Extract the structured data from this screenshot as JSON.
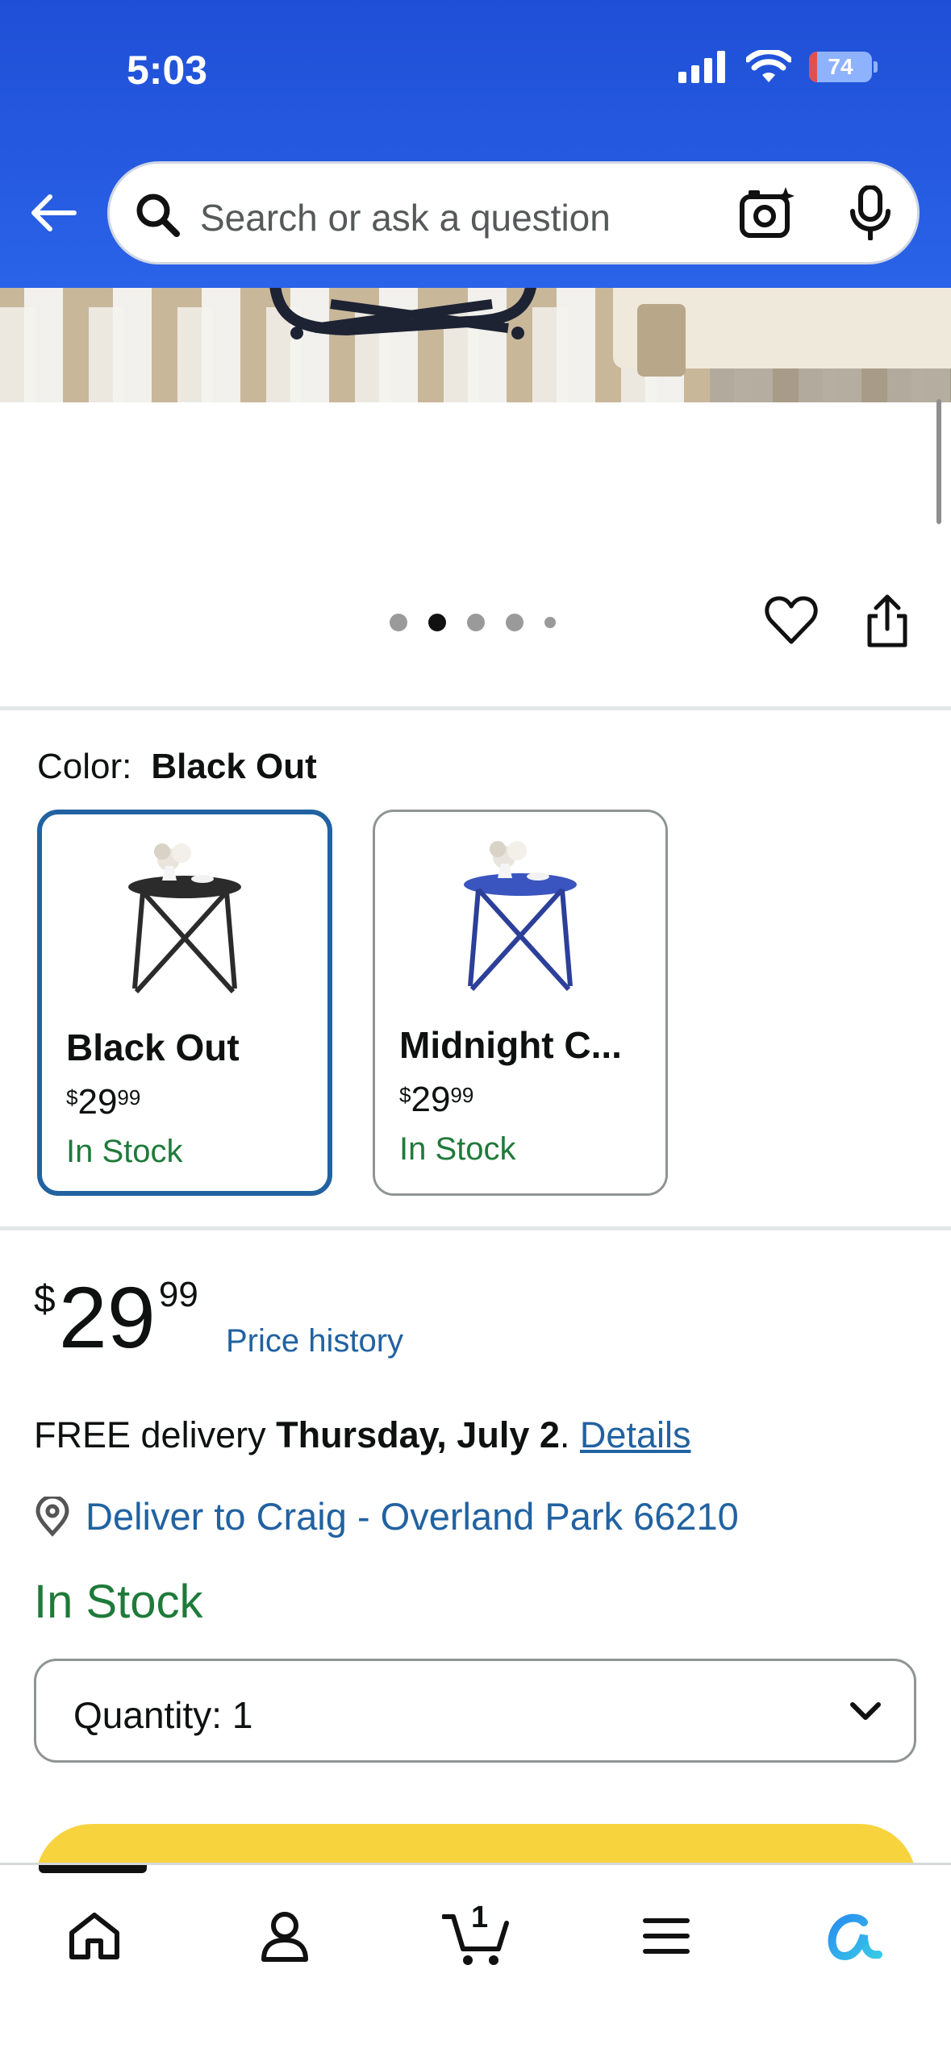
{
  "status_bar": {
    "time": "5:03",
    "battery": "74"
  },
  "search": {
    "placeholder": "Search or ask a question"
  },
  "carousel": {
    "dot_count": 5,
    "active_index": 1
  },
  "color_selector": {
    "label": "Color:",
    "selected": "Black Out",
    "options": [
      {
        "name": "Black Out",
        "price_dollars": "29",
        "price_cents": "99",
        "stock": "In Stock",
        "selected": true,
        "color": "#2b2b2b"
      },
      {
        "name": "Midnight C...",
        "price_dollars": "29",
        "price_cents": "99",
        "stock": "In Stock",
        "selected": false,
        "color": "#2c47a8"
      }
    ]
  },
  "price": {
    "currency": "$",
    "dollars": "29",
    "cents": "99",
    "history_link": "Price history"
  },
  "delivery": {
    "prefix": "FREE delivery",
    "date": "Thursday, July 2",
    "period": ".",
    "details_link": "Details"
  },
  "deliver_to": {
    "text": "Deliver to Craig - Overland Park 66210"
  },
  "stock_status": "In Stock",
  "quantity": {
    "label": "Quantity:",
    "value": "1"
  },
  "bottom_nav": {
    "cart_count": "1",
    "items": [
      "home",
      "account",
      "cart",
      "menu",
      "ai-assistant"
    ]
  },
  "colors": {
    "header_blue": "#2a63e8",
    "link_blue": "#2162a1",
    "stock_green": "#1f7a3a",
    "buy_yellow": "#f7d33e",
    "selected_border": "#2162a1"
  }
}
